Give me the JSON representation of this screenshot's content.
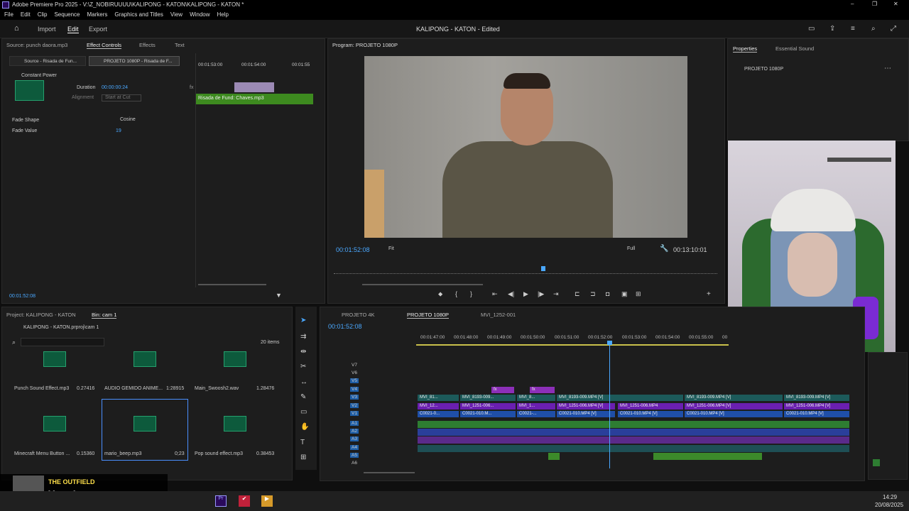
{
  "window": {
    "title": "Adobe Premiere Pro 2025 - V:\\Z_NOBIRUUUU\\KALIPONG - KATON\\KALIPONG - KATON *",
    "controls": [
      "–",
      "❐",
      "✕"
    ]
  },
  "menu": [
    "File",
    "Edit",
    "Clip",
    "Sequence",
    "Markers",
    "Graphics and Titles",
    "View",
    "Window",
    "Help"
  ],
  "header": {
    "tabs": [
      "Import",
      "Edit",
      "Export"
    ],
    "active": "Edit",
    "project_title": "KALIPONG - KATON",
    "status": "- Edited"
  },
  "source_panel": {
    "tabs": [
      "Source: punch daora.mp3",
      "Effect Controls",
      "Effects",
      "Text"
    ],
    "subtabs": [
      "Source - Risada de Fun...",
      "PROJETO 1080P - Risada de F..."
    ],
    "effect_name": "Constant Power",
    "duration_label": "Duration",
    "duration_value": "00:00:00:24",
    "alignment_label": "Alignment",
    "alignment_value": "Start at Cut",
    "fade_shape_label": "Fade Shape",
    "fade_shape_value": "Cosine",
    "fade_value_label": "Fade Value",
    "fade_value": "19",
    "ruler": [
      "00:01:53:00",
      "00:01:54:00",
      "00:01:55"
    ],
    "clip_label": "Risada de Fund: Chaves.mp3",
    "fx": "fx",
    "timecode": "00:01:52:08"
  },
  "program": {
    "tab": "Program: PROJETO 1080P",
    "timecode": "00:01:52:08",
    "fit": "Fit",
    "quality": "Full",
    "duration": "00:13:10:01"
  },
  "properties": {
    "tabs": [
      "Properties",
      "Essential Sound"
    ],
    "item": "PROJETO 1080P"
  },
  "project": {
    "tabs": [
      "Project: KALIPONG - KATON",
      "Bin: cam 1"
    ],
    "path": "KALIPONG - KATON.prproj\\cam 1",
    "items_count": "20 items",
    "items": [
      {
        "name": "Punch  Sound Effect.mp3",
        "dur": "0.27416"
      },
      {
        "name": "AUDIO GEMIDO ANIME...",
        "dur": "1:28915"
      },
      {
        "name": "Main_Swoosh2.wav",
        "dur": "1.28476"
      },
      {
        "name": "Minecraft Menu Button ...",
        "dur": "0.15360"
      },
      {
        "name": "mario_beep.mp3",
        "dur": "0;23"
      },
      {
        "name": "Pop sound effect.mp3",
        "dur": "0.38453"
      }
    ]
  },
  "timeline": {
    "tabs": [
      "PROJETO 4K",
      "PROJETO 1080P",
      "MVI_1252-001"
    ],
    "timecode": "00:01:52:08",
    "ruler": [
      "00:01:47:00",
      "00:01:48:00",
      "00:01:49:00",
      "00:01:50:00",
      "00:01:51:00",
      "00:01:52:00",
      "00:01:53:00",
      "00:01:54:00",
      "00:01:55:00",
      "00"
    ],
    "video_tracks": [
      "V7",
      "V6",
      "V5",
      "V4",
      "V3",
      "V2",
      "V1"
    ],
    "audio_tracks": [
      "A1",
      "A2",
      "A3",
      "A4",
      "A5",
      "A6"
    ],
    "clips_v3": [
      "MVI_81...",
      "MVI_8193-009...",
      "MVI_8...",
      "MVI_8193-009.MP4 [V]",
      "MVI_8193-009.MP4 [V]",
      "MVI_8193-009.MP4 [V]"
    ],
    "clips_v2": [
      "MVI_12...",
      "MVI_1251-006...",
      "MVI_1...",
      "MVI_1251-006.MP4 [V]",
      "MVI_1251-006.MP4",
      "MVI_1251-006.MP4 [V]",
      "MVI_1251-006.MP4 [V]"
    ],
    "clips_v1": [
      "C0021-0...",
      "C0021-010.M...",
      "C0021-...",
      "C0021-010.MP4 [V]",
      "C0021-010.MP4 [V]",
      "C0021-010.MP4 [V]",
      "C0021-010.MP4 [V]"
    ],
    "fx": "fx"
  },
  "music": {
    "artist": "THE OUTFIELD",
    "song": "Your Love"
  },
  "taskbar": {
    "time": "14:29",
    "date": "20/08/2025"
  },
  "colors": {
    "accent": "#4aa8ff",
    "video_clip": "#1f4fa8",
    "v2_clip": "#6a1fb0",
    "v3_clip": "#1c5a5a",
    "audio": "#2e7d32",
    "fx_clip": "#8c2fb8"
  }
}
